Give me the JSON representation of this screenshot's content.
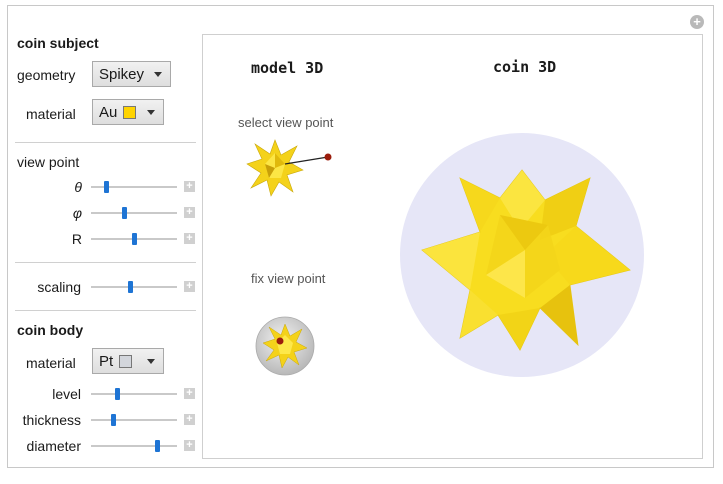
{
  "panel": {
    "coin_subject_heading": "coin subject",
    "geometry_label": "geometry",
    "geometry_value": "Spikey",
    "material_label": "material",
    "material_value": "Au",
    "material_color": "#ffd400",
    "view_point_heading": "view point",
    "theta_label": "θ",
    "theta_value": 0.18,
    "phi_label": "φ",
    "phi_value": 0.38,
    "r_label": "R",
    "r_value": 0.5,
    "scaling_label": "scaling",
    "scaling_value": 0.45,
    "coin_body_heading": "coin body",
    "body_material_label": "material",
    "body_material_value": "Pt",
    "body_material_color": "#d3d6dc",
    "level_label": "level",
    "level_value": 0.3,
    "thickness_label": "thickness",
    "thickness_value": 0.26,
    "diameter_label": "diameter",
    "diameter_value": 0.77
  },
  "viewport": {
    "model_title": "model 3D",
    "coin_title": "coin 3D",
    "select_caption": "select view point",
    "fix_caption": "fix view point",
    "coin_disc_color": "#e6e6f7",
    "spikey_color": "#f7dc1c",
    "pointer_color": "#9b1c0c"
  }
}
